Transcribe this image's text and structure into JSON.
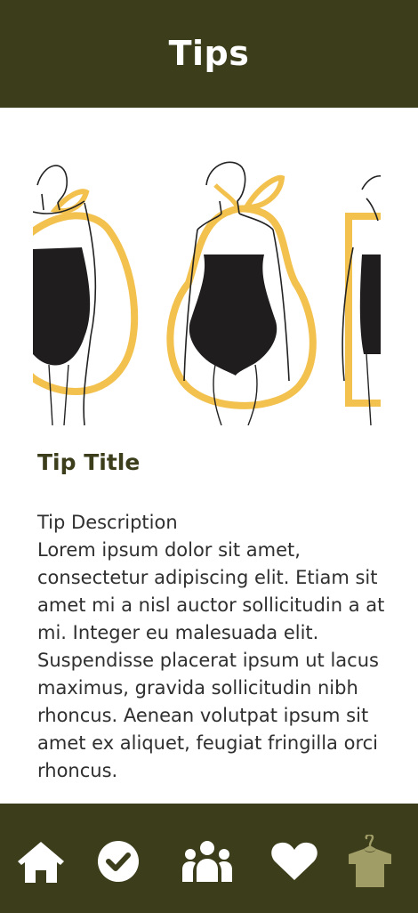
{
  "header": {
    "title": "Tips"
  },
  "tip": {
    "image_alt": "Body shape illustrations: apple, pear, rectangle",
    "title": "Tip Title",
    "description_heading": "Tip Description",
    "description_body": "Lorem ipsum dolor sit amet, consectetur adipiscing elit. Etiam sit amet mi a nisl auctor sollicitudin a at mi. Integer eu malesuada elit. Suspendisse placerat ipsum ut lacus maximus, gravida sollicitudin nibh rhoncus. Aenean volutpat ipsum sit amet ex aliquet, feugiat fringilla orci rhoncus."
  },
  "bottom_nav": {
    "items": [
      {
        "icon": "home-icon",
        "active": false
      },
      {
        "icon": "check-circle-icon",
        "active": false
      },
      {
        "icon": "people-icon",
        "active": false
      },
      {
        "icon": "heart-icon",
        "active": false
      },
      {
        "icon": "shirt-hanger-icon",
        "active": true
      }
    ]
  },
  "colors": {
    "brand_dark_olive": "#3c3d1b",
    "accent_yellow": "#f2c14e",
    "inactive_icon": "#ffffff",
    "active_icon": "#a19d67"
  }
}
